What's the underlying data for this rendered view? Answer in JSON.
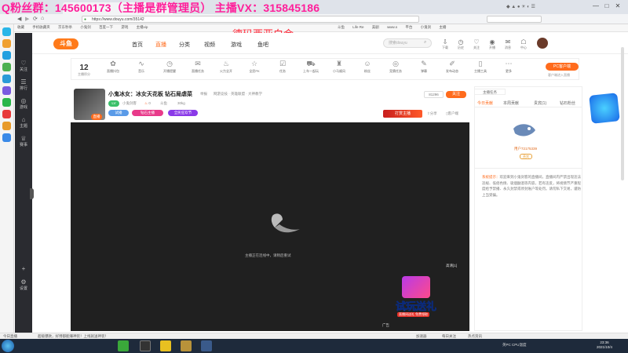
{
  "overlay": {
    "qq_group": "Q粉丝群：145600173（主播是群管理员）  主播VX：315845186",
    "subtitle": "德玛西亚白金"
  },
  "browser": {
    "url": "https://www.douyu.com/35142",
    "window_controls": [
      "—",
      "□",
      "✕"
    ]
  },
  "bookmarks": [
    "收藏",
    "手机收藏夹",
    "京东秒杀",
    "小鬼剑",
    "百度一下",
    "游戏",
    "主播vip",
    "斗鱼",
    "Life Re",
    "美剧",
    "www.s",
    "平台",
    "小鬼剑",
    "主播"
  ],
  "douyu": {
    "logo": "斗鱼",
    "nav": [
      "首页",
      "直播",
      "分类",
      "视频",
      "游戏",
      "鱼吧"
    ],
    "search_placeholder": "搜索douyu",
    "header_icons": [
      {
        "icon": "download-icon",
        "label": "下载"
      },
      {
        "icon": "history-icon",
        "label": "历史"
      },
      {
        "icon": "follow-icon",
        "label": "关注"
      },
      {
        "icon": "broadcast-icon",
        "label": "开播"
      },
      {
        "icon": "message-icon",
        "label": "消息"
      },
      {
        "icon": "center-icon",
        "label": "中心"
      }
    ],
    "side_nav": [
      {
        "icon": "heart-icon",
        "label": "关注"
      },
      {
        "icon": "rank-icon",
        "label": "排行"
      },
      {
        "icon": "game-icon",
        "label": "游戏"
      },
      {
        "icon": "home-icon",
        "label": "主题"
      },
      {
        "icon": "trophy-icon",
        "label": "赛事"
      },
      {
        "icon": "plus-icon",
        "label": ""
      },
      {
        "icon": "settings-icon",
        "label": "设置"
      }
    ]
  },
  "toolbar": {
    "level": "12",
    "level_label": "主播积分",
    "items": [
      {
        "icon": "gift-icon",
        "label": "直播抖包"
      },
      {
        "icon": "wave-icon",
        "label": "音乐"
      },
      {
        "icon": "clock-icon",
        "label": "开播提醒"
      },
      {
        "icon": "mail-icon",
        "label": "直播任务"
      },
      {
        "icon": "fire-icon",
        "label": "火力全开"
      },
      {
        "icon": "star-icon",
        "label": "全民PK"
      },
      {
        "icon": "task-icon",
        "label": "任务"
      },
      {
        "icon": "car-icon",
        "label": "上车一起玩"
      },
      {
        "icon": "bag-icon",
        "label": "小马顺风"
      },
      {
        "icon": "people-icon",
        "label": "粉丝"
      },
      {
        "icon": "target-icon",
        "label": "竞猜任务"
      },
      {
        "icon": "chat-icon",
        "label": "弹幕"
      },
      {
        "icon": "edit-icon",
        "label": "发布动态"
      },
      {
        "icon": "phone-icon",
        "label": "主播工具"
      },
      {
        "icon": "more-icon",
        "label": "更多"
      }
    ],
    "pc_button": "PC客户端",
    "pc_sub": "客户端进入直播"
  },
  "room": {
    "title": "小鬼冰女：冰女天花板 钻石局虐菜",
    "report": "举报",
    "categories": "网游竞技 · 英雄联盟 · 大神教学",
    "anchor": "小鬼剑客",
    "hot": "0",
    "fans": "斗鱼",
    "weight": "30kg",
    "room_id": "81296",
    "follow_button": "关注",
    "badges": [
      "钻石主播",
      "全民狂欢节"
    ],
    "share": "分享",
    "client": "客户端",
    "promo": "打赏主播",
    "live_tag": "直播"
  },
  "video": {
    "message": "主播正在连线中，请稍后重试",
    "quality": "高清[1]",
    "ad_label": "广告",
    "gift_banner": "试玩送礼",
    "gift_sub": "直播间送礼 免费领取"
  },
  "right_panel": {
    "tabs": [
      "今日贡献",
      "本周贡献",
      "贵宾(1)",
      "钻石粉丝"
    ],
    "top_fan": "用户72175339",
    "top_fan_badge": "贵宾",
    "system_msg_label": "系统提示：",
    "system_msg": "欢迎来到小鬼剑客的直播间，直播间内严禁出现违法违规、低俗色情、吸烟酗酒等内容，若有违反，将视情节严重程度给予禁播、永久封禁或停封账户等处罚。请勿私下交易，谨防上当受骗。",
    "float_banner": "主播任务"
  },
  "statusbar": {
    "left": "今日直播",
    "middle": "超级爆款，好博都能赚神装！上线就送神装！",
    "right_items": [
      "加速器",
      "每日关注",
      "热点资讯"
    ]
  },
  "taskbar": {
    "clock_time": "23:36",
    "clock_date": "2021/10/4",
    "tray": "英PC CPU温度"
  }
}
